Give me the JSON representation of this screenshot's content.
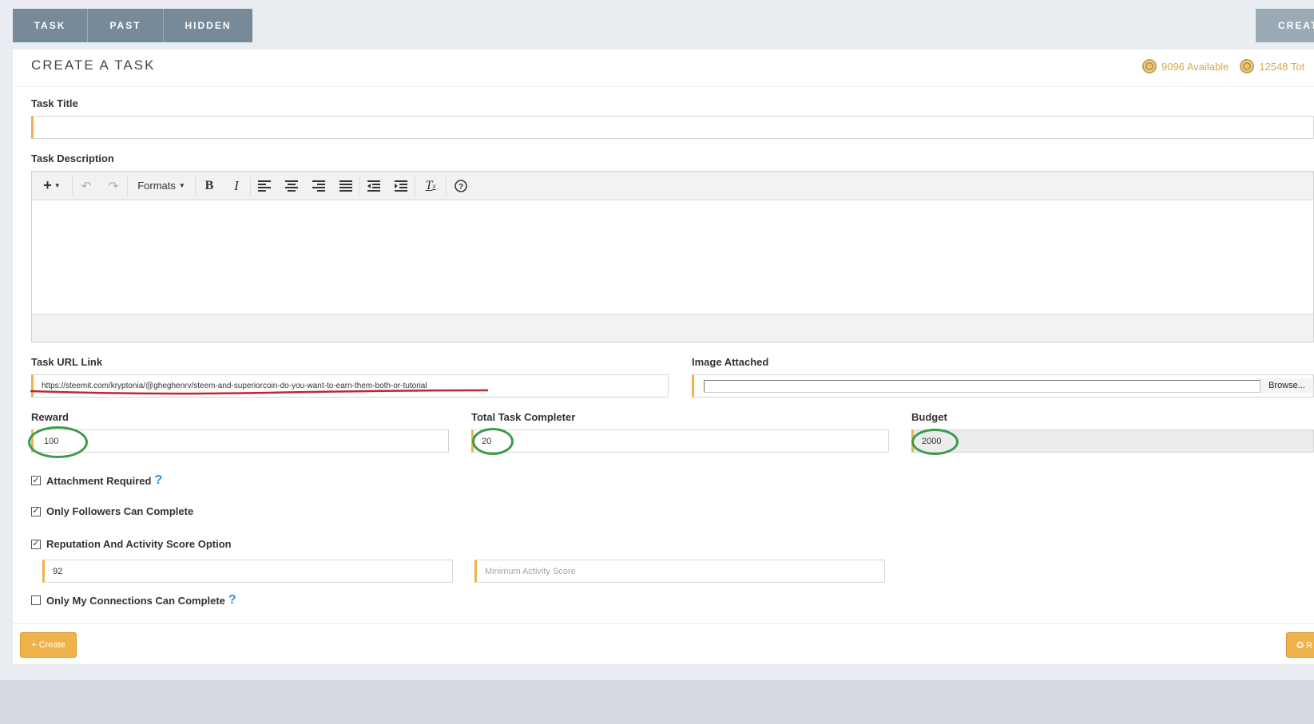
{
  "nav": {
    "tabs": [
      {
        "label": "TASK"
      },
      {
        "label": "PAST"
      },
      {
        "label": "HIDDEN"
      }
    ],
    "create_label": "CREAT"
  },
  "panel": {
    "title": "CREATE A TASK",
    "available": "9096 Available",
    "total": "12548 Tot"
  },
  "form": {
    "task_title": {
      "label": "Task Title",
      "value": ""
    },
    "task_description": {
      "label": "Task Description"
    },
    "editor": {
      "formats_label": "Formats"
    },
    "task_url": {
      "label": "Task URL Link",
      "value": "https://steemit.com/kryptonia/@gheghenrv/steem-and-superiorcoin-do-you-want-to-earn-them-both-or-tutorial"
    },
    "image_attached": {
      "label": "Image Attached",
      "browse_label": "Browse..."
    },
    "reward": {
      "label": "Reward",
      "value": "100"
    },
    "total_task_completer": {
      "label": "Total Task Completer",
      "value": "20"
    },
    "budget": {
      "label": "Budget",
      "value": "2000"
    },
    "attachment_required": {
      "label": "Attachment Required",
      "checked": true,
      "help": "?"
    },
    "only_followers": {
      "label": "Only Followers Can Complete",
      "checked": true
    },
    "reputation": {
      "label": "Reputation And Activity Score Option",
      "checked": true,
      "value": "92",
      "placeholder": "Minimum Activity Score"
    },
    "only_connections": {
      "label": "Only My Connections Can Complete",
      "checked": false,
      "help": "?"
    }
  },
  "buttons": {
    "create": "+ Create",
    "reset": "✪ R"
  },
  "colors": {
    "accent": "#f0b24a",
    "tab": "#768a9a",
    "coin": "#d9a84b",
    "annotation_green": "#3a9b4a",
    "annotation_red": "#c0272d"
  }
}
